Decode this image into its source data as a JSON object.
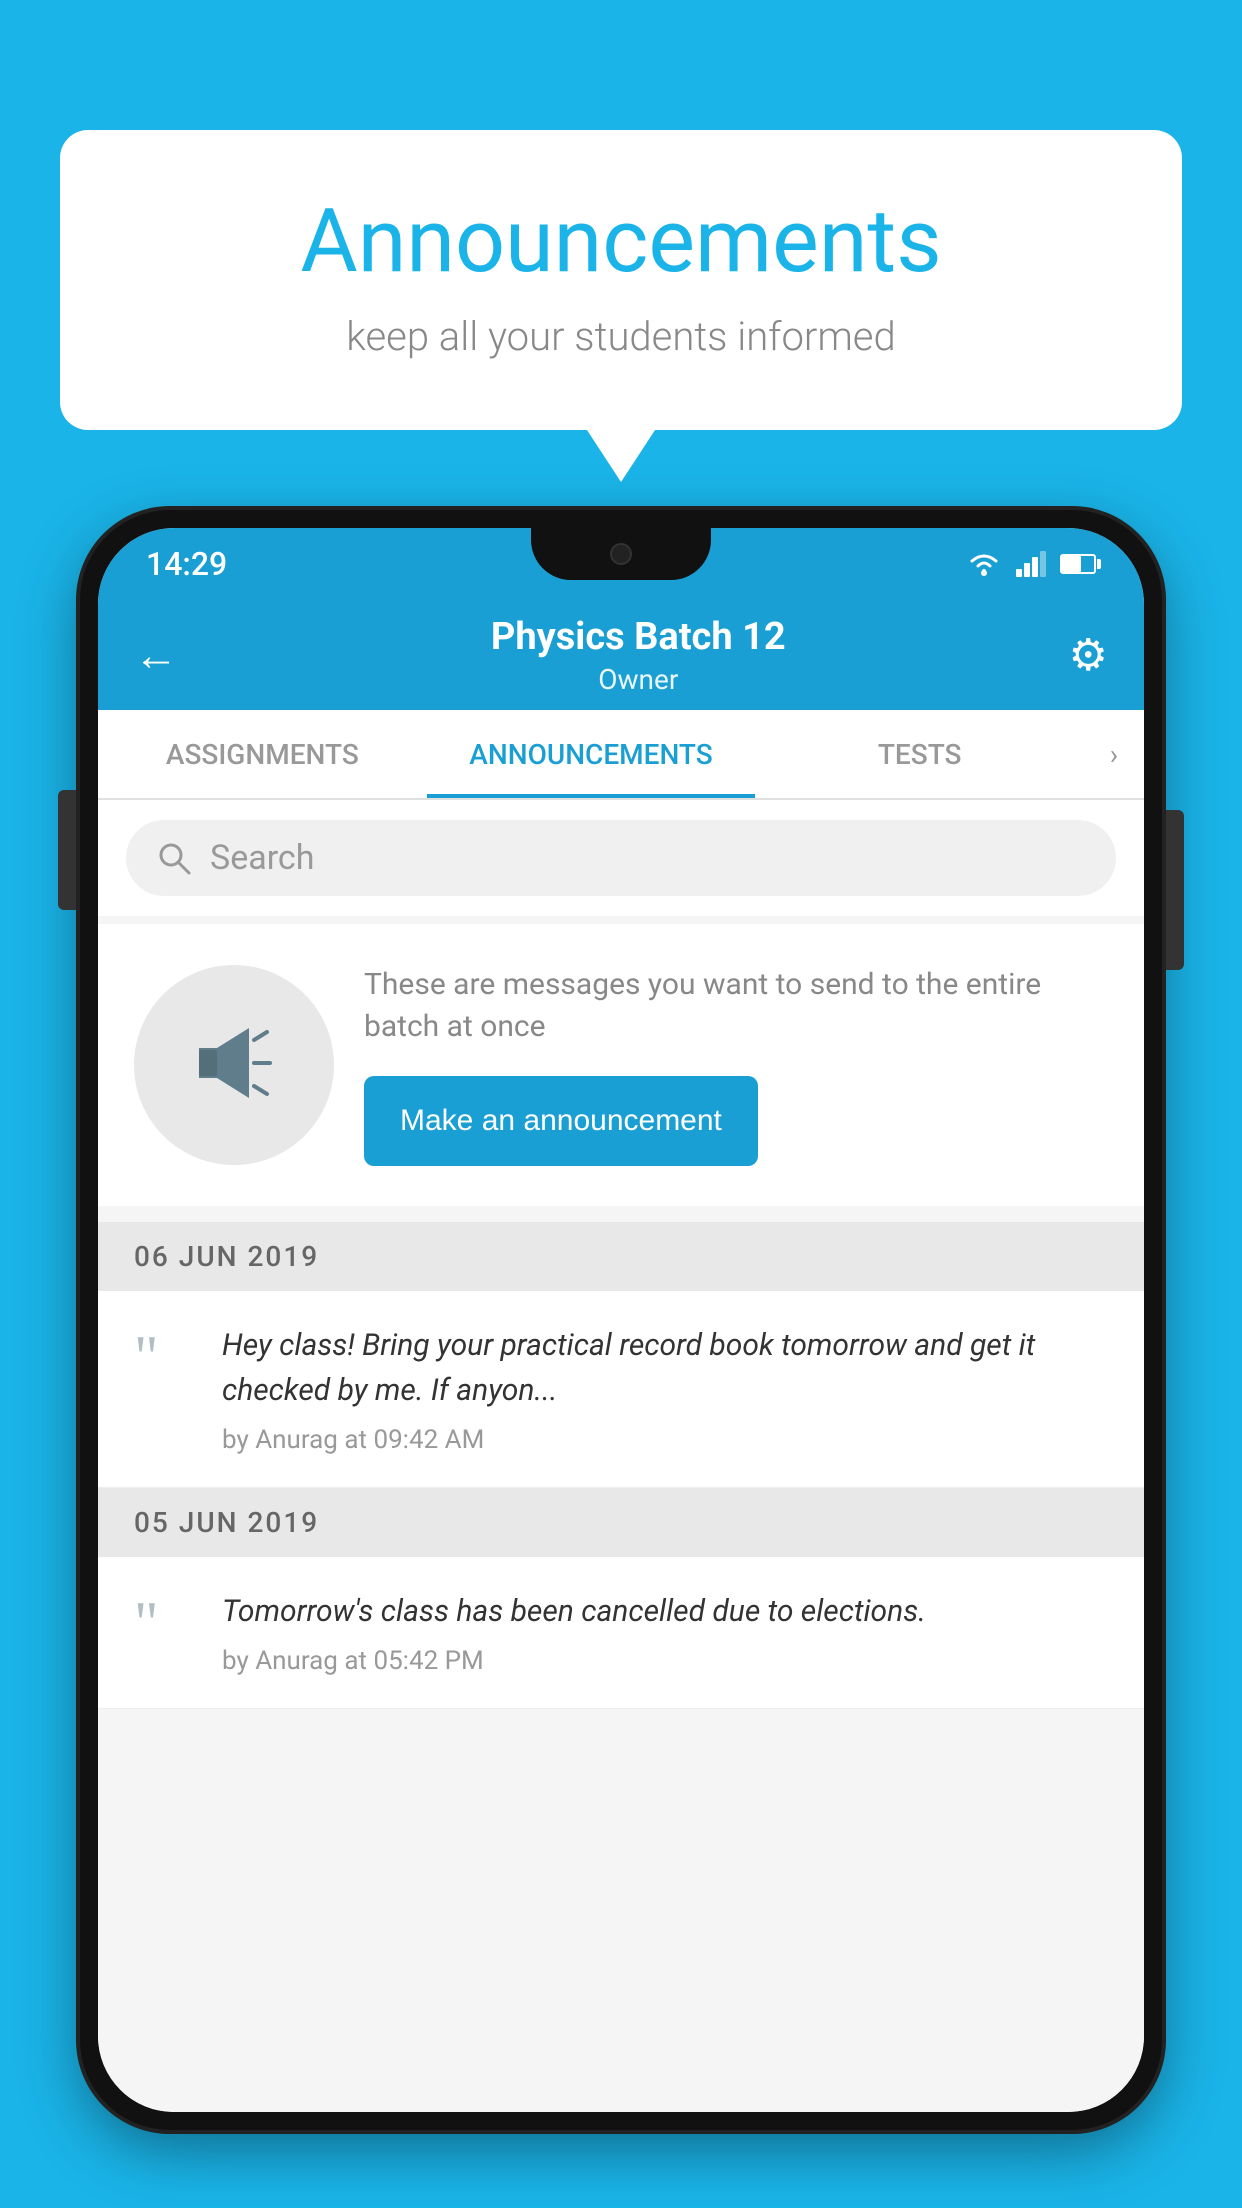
{
  "background_color": "#1ab4e8",
  "speech_bubble": {
    "title": "Announcements",
    "subtitle": "keep all your students informed"
  },
  "phone": {
    "status_bar": {
      "time": "14:29"
    },
    "toolbar": {
      "title": "Physics Batch 12",
      "subtitle": "Owner",
      "back_label": "←",
      "settings_label": "⚙"
    },
    "tabs": [
      {
        "label": "ASSIGNMENTS",
        "active": false
      },
      {
        "label": "ANNOUNCEMENTS",
        "active": true
      },
      {
        "label": "TESTS",
        "active": false
      }
    ],
    "search": {
      "placeholder": "Search"
    },
    "promo": {
      "description": "These are messages you want to send to the entire batch at once",
      "button_label": "Make an announcement"
    },
    "announcements": [
      {
        "date": "06  JUN  2019",
        "text": "Hey class! Bring your practical record book tomorrow and get it checked by me. If anyon...",
        "meta": "by Anurag at 09:42 AM"
      },
      {
        "date": "05  JUN  2019",
        "text": "Tomorrow's class has been cancelled due to elections.",
        "meta": "by Anurag at 05:42 PM"
      }
    ]
  }
}
